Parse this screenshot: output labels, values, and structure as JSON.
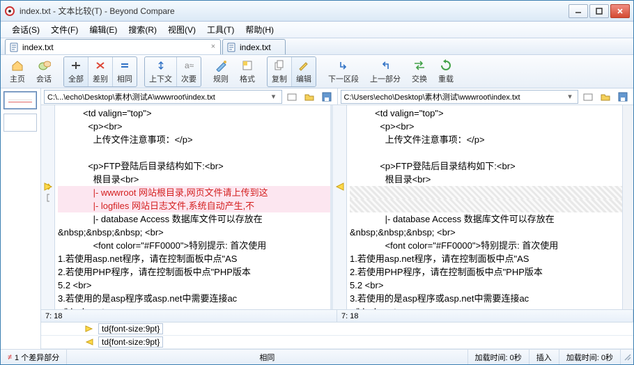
{
  "title": "index.txt - 文本比较(T) - Beyond Compare",
  "menu": [
    "会话(S)",
    "文件(F)",
    "编辑(E)",
    "搜索(R)",
    "视图(V)",
    "工具(T)",
    "帮助(H)"
  ],
  "tabs": [
    {
      "icon": "doc",
      "label": "index.txt"
    },
    {
      "icon": "doc",
      "label": "index.txt"
    }
  ],
  "toolbar": {
    "home": "主页",
    "session": "会话",
    "all": "全部",
    "diff": "差别",
    "same": "相同",
    "context": "上下文",
    "minor": "次要",
    "rules": "规则",
    "format": "格式",
    "copy": "复制",
    "edit": "编辑",
    "nextsec": "下一区段",
    "prevpart": "上一部分",
    "swap": "交换",
    "reload": "重载"
  },
  "paths": {
    "left": "C:\\...\\echo\\Desktop\\素材\\测试A\\wwwroot\\index.txt",
    "right": "C:\\Users\\echo\\Desktop\\素材\\测试\\wwwroot\\index.txt"
  },
  "code_left": [
    "          <td valign=\"top\">",
    "            <p><br>",
    "              上传文件注意事项：</p>",
    "",
    "            <p>FTP登陆后目录结构如下:<br>",
    "              根目录<br>",
    "              |- wwwroot 网站根目录,网页文件请上传到这",
    "              |- logfiles 网站日志文件,系统自动产生,不",
    "              |- database Access 数据库文件可以存放在",
    "&nbsp;&nbsp;&nbsp; <br>",
    "              <font color=\"#FF0000\">特别提示: 首次使用",
    "1.若使用asp.net程序，请在控制面板中点\"AS",
    "2.若使用PHP程序，请在控制面板中点\"PHP版本",
    "5.2 <br>",
    "3.若使用的是asp程序或asp.net中需要连接ac",
    "</blockquote>"
  ],
  "diff_left_rows": [
    6,
    7
  ],
  "code_right": [
    "          <td valign=\"top\">",
    "            <p><br>",
    "              上传文件注意事项：</p>",
    "",
    "            <p>FTP登陆后目录结构如下:<br>",
    "              根目录<br>",
    "",
    "",
    "              |- database Access 数据库文件可以存放在",
    "&nbsp;&nbsp;&nbsp; <br>",
    "              <font color=\"#FF0000\">特别提示: 首次使用",
    "1.若使用asp.net程序，请在控制面板中点\"AS",
    "2.若使用PHP程序，请在控制面板中点\"PHP版本",
    "5.2 <br>",
    "3.若使用的是asp程序或asp.net中需要连接ac",
    "</blockquote>"
  ],
  "hatch_right_rows": [
    6,
    7
  ],
  "cursor": {
    "left": "7: 18",
    "right": "7: 18"
  },
  "bottom_rule": "td{font-size:9pt}",
  "status": {
    "diff": "1 个差异部分",
    "same": "相同",
    "loadtime": "加载时间: 0秒",
    "insert": "插入",
    "loadtime2": "加载时间: 0秒"
  }
}
